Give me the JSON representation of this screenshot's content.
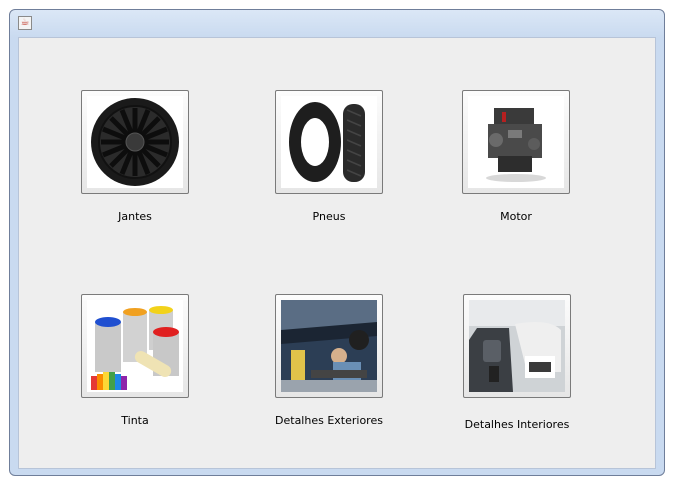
{
  "window": {
    "icon": "java-coffee-icon"
  },
  "items": [
    {
      "label": "Jantes",
      "icon": "wheel-rim-image"
    },
    {
      "label": "Pneus",
      "icon": "tire-image"
    },
    {
      "label": "Motor",
      "icon": "engine-image"
    },
    {
      "label": "Tinta",
      "icon": "paint-cans-image"
    },
    {
      "label": "Detalhes Exteriores",
      "icon": "mechanic-under-car-image"
    },
    {
      "label": "Detalhes Interiores",
      "icon": "car-interior-image"
    }
  ]
}
